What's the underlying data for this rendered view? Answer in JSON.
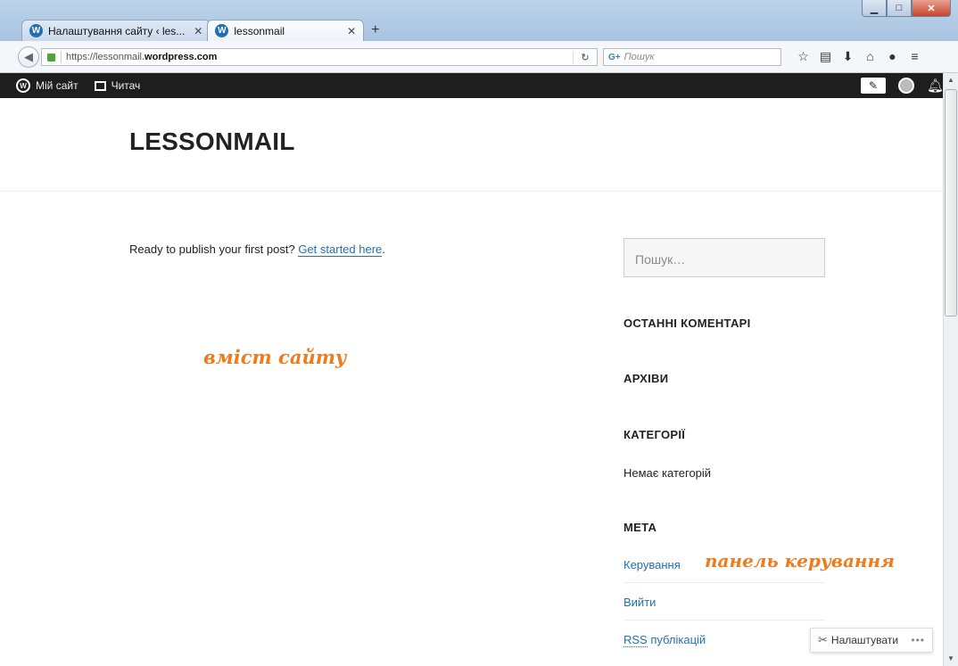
{
  "browser": {
    "tabs": [
      {
        "label": "Налаштування сайту ‹ les..."
      },
      {
        "label": "lessonmail"
      }
    ],
    "url_prefix": "https://lessonmail.",
    "url_host": "wordpress.com",
    "search_placeholder": "Пошук"
  },
  "adminbar": {
    "my_site": "Мій сайт",
    "reader": "Читач"
  },
  "site": {
    "title": "LESSONMAIL",
    "ready_text": "Ready to publish your first post? ",
    "ready_link": "Get started here",
    "ready_end": "."
  },
  "annotations": {
    "content": "вміст сайту",
    "panel": "панель керування"
  },
  "sidebar": {
    "search_placeholder": "Пошук…",
    "recent_comments": "ОСТАННІ КОМЕНТАРІ",
    "archives": "АРХІВИ",
    "categories": "КАТЕГОРІЇ",
    "no_categories": "Немає категорій",
    "meta": "МЕТА",
    "meta_links": {
      "admin": "Керування",
      "logout": "Вийти",
      "rss_abbr": "RSS",
      "rss_rest": " публікацій"
    }
  },
  "customize": {
    "label": "Налаштувати"
  },
  "colors": {
    "link": "#2271b1",
    "annotation": "#f07b1d",
    "adminbar": "#1e1e1e"
  }
}
